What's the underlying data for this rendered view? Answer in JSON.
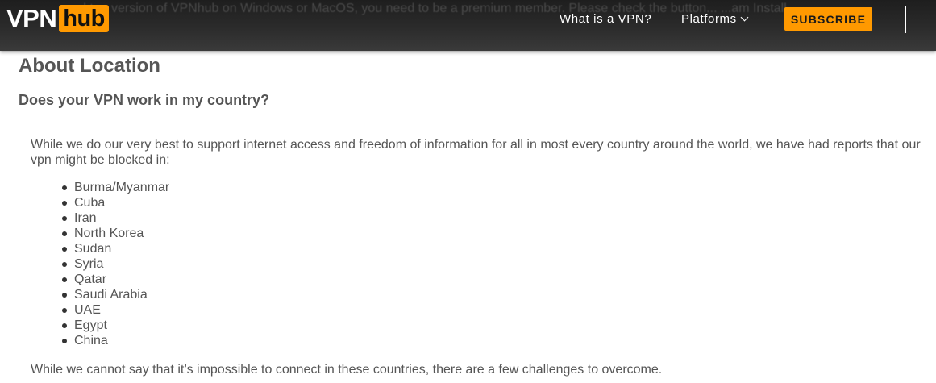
{
  "header": {
    "logo_text_vpn": "VPN",
    "logo_text_hub": "hub",
    "background_text": "...ktop version of VPNhub on Windows or MacOS, you need to be a premium member. Please check the button... ...am Install",
    "nav": {
      "what_is_vpn": "What is a VPN?",
      "platforms": "Platforms"
    },
    "subscribe_label": "SUBSCRIBE",
    "accent_color": "#ff9900"
  },
  "content": {
    "title": "About Location",
    "question": "Does your VPN work in my country?",
    "intro": "While we do our very best to support internet access and freedom of information for all in most every country around the world, we have had reports that our vpn might be blocked in:",
    "countries": [
      "Burma/Myanmar",
      "Cuba",
      "Iran",
      "North Korea",
      "Sudan",
      "Syria",
      "Qatar",
      "Saudi Arabia",
      "UAE",
      "Egypt",
      "China"
    ],
    "outro": "While we cannot say that it’s impossible to connect in these countries, there are a few challenges to overcome."
  }
}
